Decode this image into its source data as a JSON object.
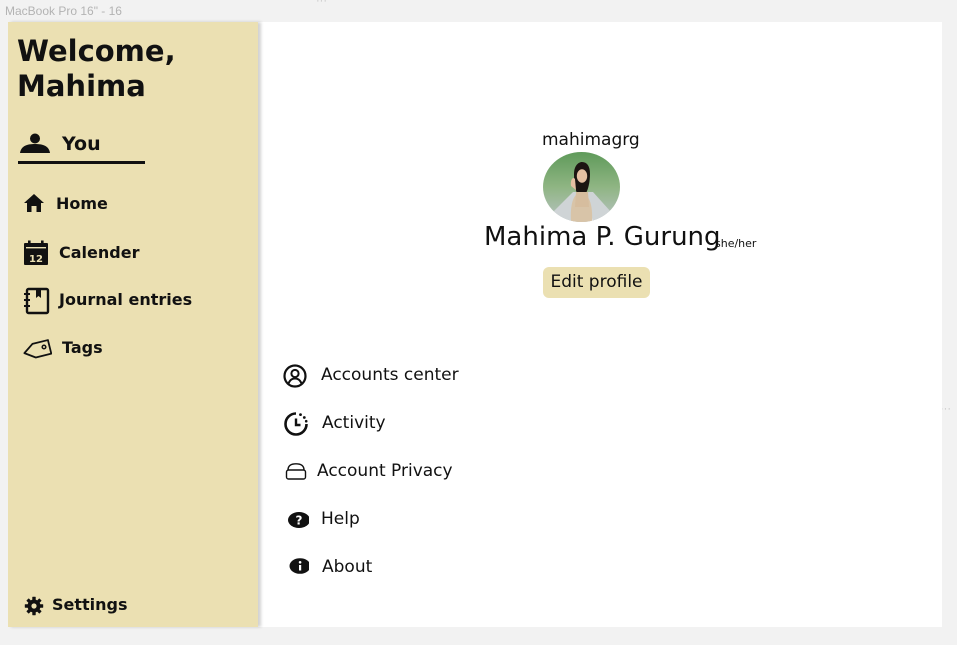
{
  "frame": {
    "label": "MacBook Pro 16\" - 16",
    "handle_top": "···",
    "handle_right": "···"
  },
  "sidebar": {
    "welcome": "Welcome, Mahima",
    "you_tab": {
      "label": "You",
      "icon": "person-icon"
    },
    "items": [
      {
        "label": "Home",
        "icon": "home-icon"
      },
      {
        "label": "Calender",
        "icon": "calendar-icon",
        "icon_text": "12"
      },
      {
        "label": "Journal entries",
        "icon": "journal-icon"
      },
      {
        "label": "Tags",
        "icon": "tag-icon"
      }
    ],
    "settings": {
      "label": "Settings",
      "icon": "gear-icon"
    }
  },
  "profile": {
    "username": "mahimagrg",
    "name": "Mahima P. Gurung",
    "pronouns": "she/her",
    "edit_button": "Edit profile"
  },
  "menu": [
    {
      "label": "Accounts center",
      "icon": "account-circle-icon"
    },
    {
      "label": "Activity",
      "icon": "activity-clock-icon"
    },
    {
      "label": "Account Privacy",
      "icon": "privacy-icon"
    },
    {
      "label": "Help",
      "icon": "help-icon"
    },
    {
      "label": "About",
      "icon": "info-icon"
    }
  ],
  "colors": {
    "sidebar_bg": "#ebe0b2",
    "button_bg": "#ebe0b2",
    "text": "#111111",
    "canvas_bg": "#f2f2f2"
  }
}
